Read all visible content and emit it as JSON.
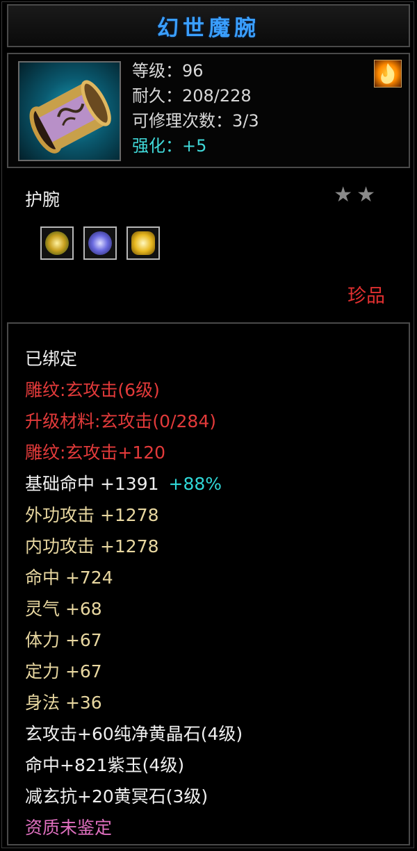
{
  "item": {
    "title": "幻世魔腕",
    "level_line": "等级：96",
    "durability_line": "耐久：208/228",
    "repairs_line": "可修理次数：3/3",
    "enhance_line": "强化：+5",
    "type": "护腕",
    "stars": [
      "★",
      "★"
    ],
    "rarity": "珍品"
  },
  "icons": {
    "item": "bracer-icon",
    "badge": "fire-badge-icon",
    "sockets": [
      "yellow-crystal-gem-icon",
      "purple-jade-gem-icon",
      "golden-gem-icon"
    ]
  },
  "attributes": {
    "bound": "已绑定",
    "engrave": "雕纹:玄攻击(6级)",
    "upgrade_material": "升级材料:玄攻击(0/284)",
    "engrave_bonus": "雕纹:玄攻击+120",
    "hit_base": "基础命中 +1391",
    "hit_base_pct": "+88%",
    "outer_attack": "外功攻击 +1278",
    "inner_attack": "内功攻击 +1278",
    "hit": "命中 +724",
    "spirit": "灵气 +68",
    "stamina": "体力 +67",
    "focus": "定力 +67",
    "agility": "身法 +36",
    "gem1": "玄攻击+60纯净黄晶石(4级)",
    "gem2": "命中+821紫玉(4级)",
    "gem3": "减玄抗+20黄冥石(3级)",
    "quality": "资质未鉴定"
  },
  "colors": {
    "title": "#3a9fff",
    "enhance": "#40d8d8",
    "rarity": "#e03030",
    "engrave": "#e23a3a",
    "attribute": "#e8d7a0",
    "quality": "#e070c0"
  }
}
